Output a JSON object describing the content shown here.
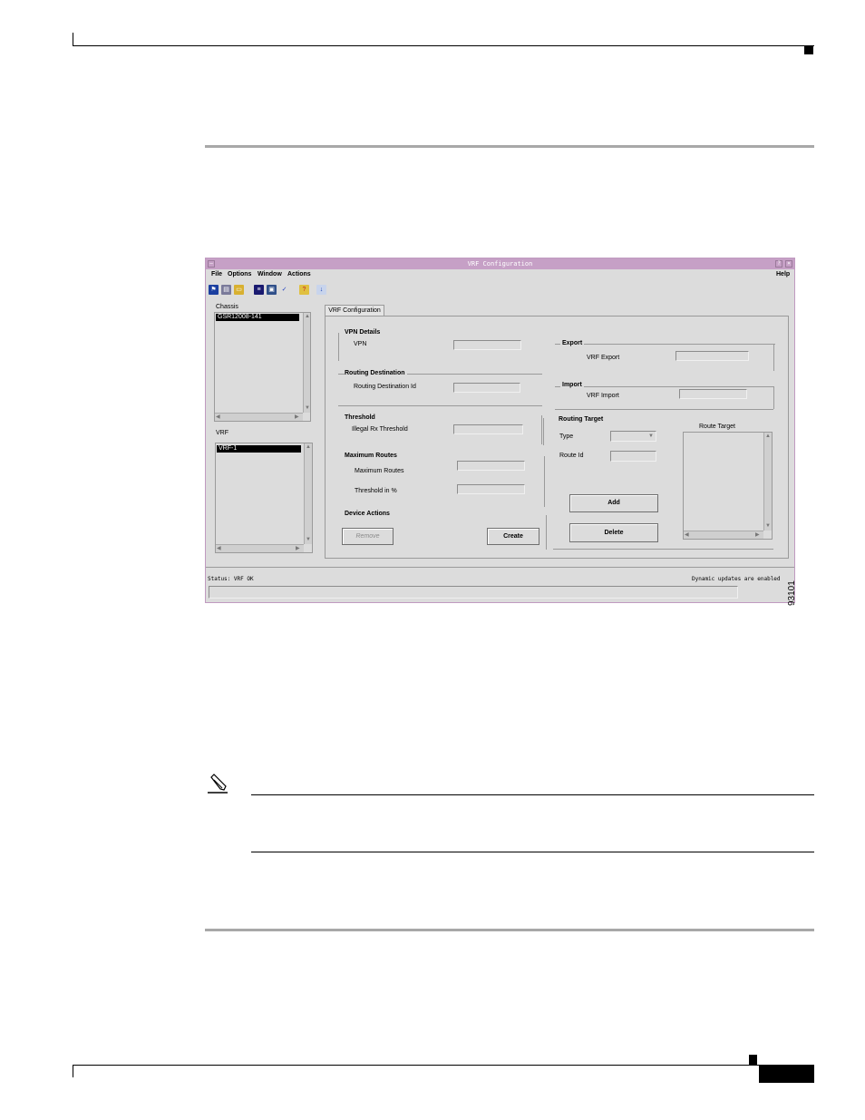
{
  "window": {
    "title": "VRF Configuration",
    "menus": [
      "File",
      "Options",
      "Window",
      "Actions"
    ],
    "help_menu": "Help",
    "toolbar_icons": [
      "run-icon",
      "print-icon",
      "open-folder-icon",
      "list-icon",
      "display-icon",
      "check-icon",
      "help-icon",
      "info-icon"
    ]
  },
  "left_panel": {
    "chassis_label": "Chassis",
    "chassis_items": [
      "GSR12008-141"
    ],
    "vrf_label": "VRF",
    "vrf_items": [
      "VRF-1"
    ]
  },
  "tab": {
    "label": "VRF Configuration"
  },
  "vpn_details": {
    "heading": "VPN Details",
    "vpn_label": "VPN",
    "vpn_value": ""
  },
  "routing_destination": {
    "heading": "Routing Destination",
    "id_label": "Routing Destination Id",
    "id_value": ""
  },
  "threshold": {
    "heading": "Threshold",
    "illegal_label": "Illegal Rx Threshold",
    "illegal_value": ""
  },
  "maximum_routes": {
    "heading": "Maximum Routes",
    "max_label": "Maximum Routes",
    "max_value": "",
    "pct_label": "Threshold in %",
    "pct_value": ""
  },
  "device_actions": {
    "heading": "Device Actions",
    "remove_label": "Remove",
    "create_label": "Create"
  },
  "export": {
    "heading": "Export",
    "label": "VRF Export",
    "value": ""
  },
  "import": {
    "heading": "Import",
    "label": "VRF Import",
    "value": ""
  },
  "routing_target": {
    "heading": "Routing Target",
    "type_label": "Type",
    "route_id_label": "Route Id",
    "route_target_label": "Route Target",
    "add_label": "Add",
    "delete_label": "Delete"
  },
  "status": {
    "left": "Status: VRF OK",
    "right": "Dynamic updates are enabled"
  },
  "figure_id": "93101"
}
